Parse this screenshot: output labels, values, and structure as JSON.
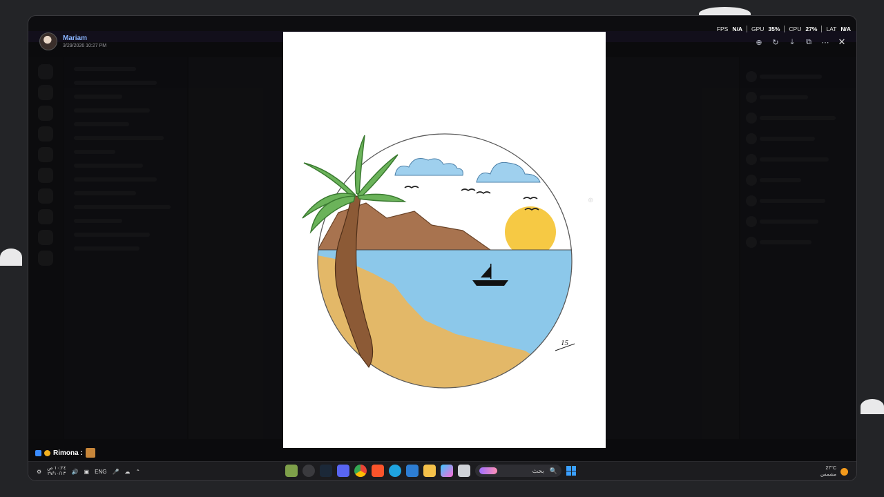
{
  "author": {
    "name": "Mariam",
    "time": "3/29/2026 10:27 PM"
  },
  "overlay": {
    "fps_label": "FPS",
    "fps_value": "N/A",
    "gpu_label": "GPU",
    "gpu_value": "35%",
    "cpu_label": "CPU",
    "cpu_value": "27%",
    "lat_label": "LAT",
    "lat_value": "N/A"
  },
  "toast": {
    "name": "Rimona :"
  },
  "taskbar": {
    "lang": "ENG",
    "clock_time": "١٠:٢٤ ص",
    "clock_date": "٢٧/١٠/١٣",
    "search_placeholder": "بحث",
    "weather_temp": "27°C",
    "weather_desc": "مشمس"
  },
  "drawing": {
    "signature": "15"
  },
  "colors": {
    "accent": "#5865f2",
    "name_blue": "#8ab4ff",
    "sea": "#8cc8ea",
    "sand": "#e3b868",
    "mountain": "#a8734f",
    "sun": "#f6c944"
  }
}
